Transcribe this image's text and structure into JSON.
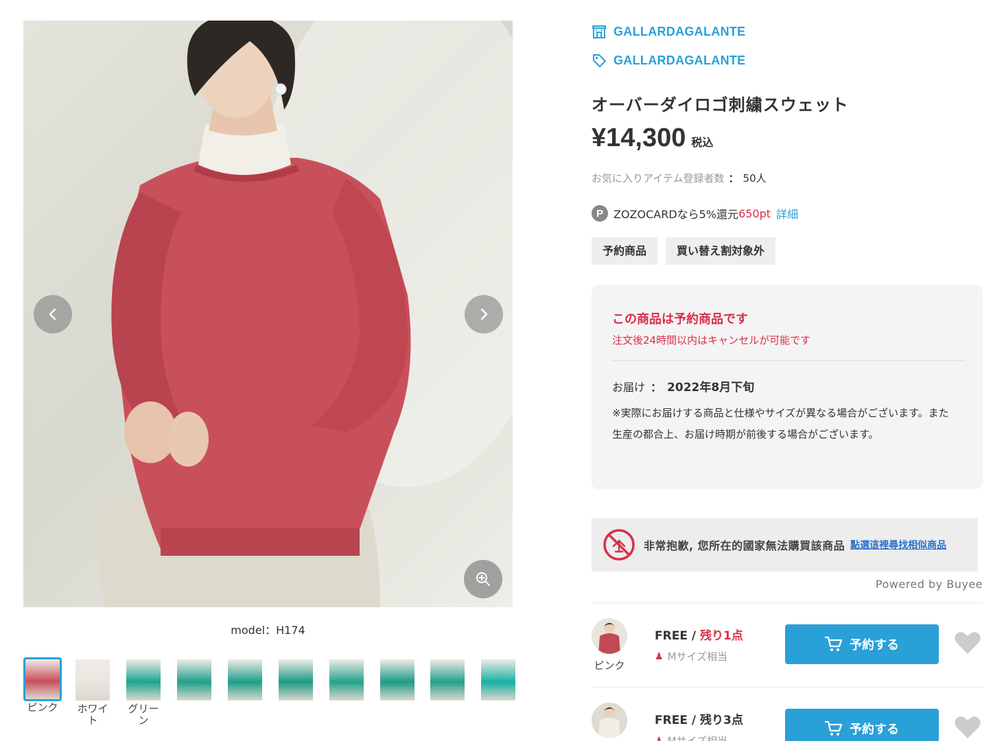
{
  "brand": {
    "shop_name": "GALLARDAGALANTE",
    "brand_name": "GALLARDAGALANTE"
  },
  "product": {
    "title": "オーバーダイロゴ刺繍スウェット",
    "price": "¥14,300",
    "tax_label": "税込",
    "favorites_label": "お気に入りアイテム登録者数",
    "favorites_sep": "：",
    "favorites_count": "50人"
  },
  "points": {
    "icon_letter": "P",
    "text_prefix": "ZOZOCARDなら5%還元",
    "points_value": "650pt",
    "detail_link": "詳細"
  },
  "tags": [
    "予約商品",
    "買い替え割対象外"
  ],
  "reservation": {
    "title": "この商品は予約商品です",
    "subtitle": "注文後24時間以内はキャンセルが可能です",
    "delivery_label": "お届け",
    "delivery_sep": "：",
    "delivery_value": "2022年8月下旬",
    "note": "※実際にお届けする商品と仕様やサイズが異なる場合がございます。また生産の都合上、お届け時期が前後する場合がございます。"
  },
  "buyee": {
    "message": "非常抱歉, 您所在的國家無法購買該商品",
    "link": "點選這裡尋找相似商品",
    "powered": "Powered by Buyee"
  },
  "gallery": {
    "model_caption": "model：H174",
    "thumbnails": [
      {
        "label": "ピンク",
        "color": "#c7505a",
        "active": true
      },
      {
        "label": "ホワイト",
        "color": "#e9e6df",
        "active": false
      },
      {
        "label": "グリーン",
        "color": "#1ea48f",
        "active": false
      },
      {
        "label": "",
        "color": "#20a08c",
        "active": false
      },
      {
        "label": "",
        "color": "#1f9e8a",
        "active": false
      },
      {
        "label": "",
        "color": "#1c9985",
        "active": false
      },
      {
        "label": "",
        "color": "#24a28e",
        "active": false
      },
      {
        "label": "",
        "color": "#1d9c88",
        "active": false
      },
      {
        "label": "",
        "color": "#26a08d",
        "active": false
      },
      {
        "label": "",
        "color": "#18b0a3",
        "active": false
      }
    ]
  },
  "skus": [
    {
      "color_name": "ピンク",
      "size": "FREE",
      "slash": "/",
      "stock": "残り1点",
      "fit": "Mサイズ相当",
      "button": "予約する",
      "avatar_color": "#c24a55"
    },
    {
      "color_name": "",
      "size": "FREE",
      "slash": "/",
      "stock": "残り3点",
      "fit": "Mサイズ相当",
      "button": "予約する",
      "avatar_color": "#e4e0d8"
    }
  ]
}
